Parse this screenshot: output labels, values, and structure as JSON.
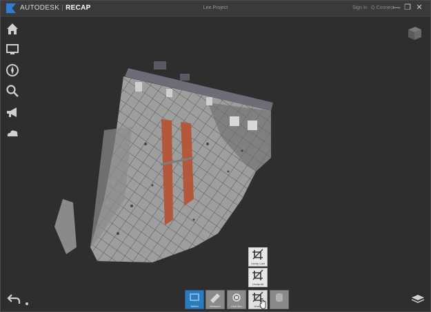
{
  "app": {
    "brand_name": "AUTODESK",
    "brand_product": "RECAP",
    "project_title": "Lee Project",
    "sign_in": "Sign In",
    "connect": "Connect"
  },
  "window_controls": {
    "minimize": "—",
    "maximize": "❐",
    "close": "✕"
  },
  "left_nav": [
    "home-icon",
    "monitor-icon",
    "compass-icon",
    "search-icon",
    "megaphone-icon",
    "cloud-icon"
  ],
  "toolbar": {
    "buttons": [
      {
        "name": "select",
        "label": "Select",
        "active": true
      },
      {
        "name": "measure",
        "label": "Measure",
        "active": false
      },
      {
        "name": "limit-box",
        "label": "Limit Box",
        "active": false
      },
      {
        "name": "unclip",
        "label": "Unclip",
        "active": false
      },
      {
        "name": "region",
        "label": "",
        "active": false
      }
    ],
    "popup": [
      {
        "name": "unclip-last",
        "label": "Unclip Last"
      },
      {
        "name": "unclip-all",
        "label": "Unclip All"
      }
    ]
  },
  "colors": {
    "accent": "#2b7bbf",
    "background": "#2e2e2e",
    "brick": "#b3583a"
  }
}
